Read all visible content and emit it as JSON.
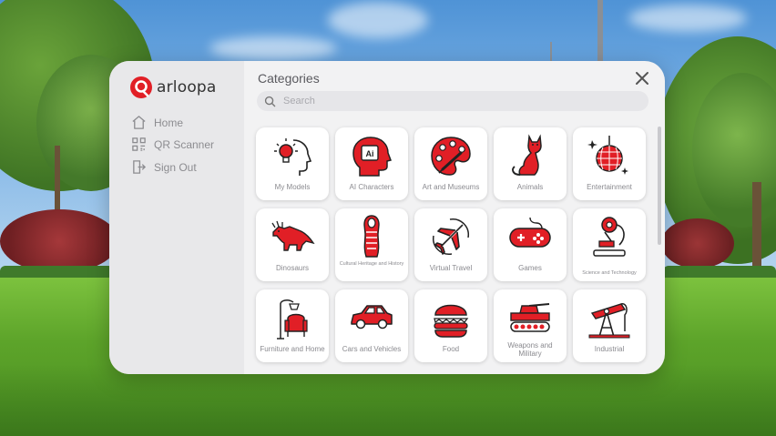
{
  "brand": {
    "name": "arloopa",
    "accent": "#e11f26"
  },
  "sidebar": {
    "items": [
      {
        "label": "Home",
        "icon": "home-icon"
      },
      {
        "label": "QR Scanner",
        "icon": "qr-icon"
      },
      {
        "label": "Sign Out",
        "icon": "sign-out-icon"
      }
    ]
  },
  "main": {
    "title": "Categories",
    "search_placeholder": "Search",
    "categories": [
      {
        "label": "My Models",
        "icon": "lightbulb-head-icon"
      },
      {
        "label": "AI Characters",
        "icon": "ai-head-icon"
      },
      {
        "label": "Art and Museums",
        "icon": "palette-icon"
      },
      {
        "label": "Animals",
        "icon": "cat-icon"
      },
      {
        "label": "Entertainment",
        "icon": "disco-ball-icon"
      },
      {
        "label": "Dinosaurs",
        "icon": "dinosaur-icon"
      },
      {
        "label": "Cultural Heritage and History",
        "icon": "sarcophagus-icon"
      },
      {
        "label": "Virtual Travel",
        "icon": "airplane-icon"
      },
      {
        "label": "Games",
        "icon": "gamepad-icon"
      },
      {
        "label": "Science and Technology",
        "icon": "microscope-icon"
      },
      {
        "label": "Furniture and Home",
        "icon": "lamp-chair-icon"
      },
      {
        "label": "Cars and Vehicles",
        "icon": "car-icon"
      },
      {
        "label": "Food",
        "icon": "burger-icon"
      },
      {
        "label": "Weapons and Military",
        "icon": "tank-icon"
      },
      {
        "label": "Industrial",
        "icon": "oil-pump-icon"
      }
    ]
  }
}
